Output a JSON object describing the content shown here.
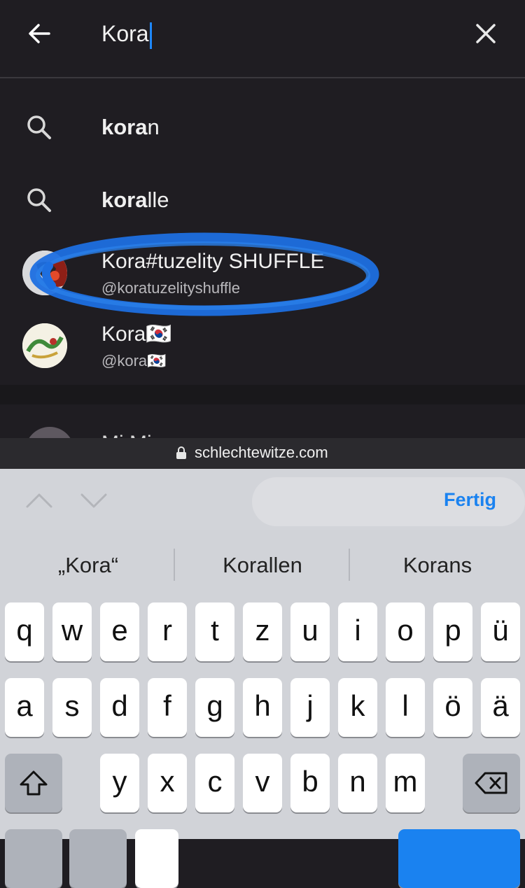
{
  "search": {
    "query": "Kora"
  },
  "suggestions": [
    {
      "bold": "kora",
      "rest": "n"
    },
    {
      "bold": "kora",
      "rest": "lle"
    }
  ],
  "users": [
    {
      "name": "Kora#tuzelity SHUFFLE",
      "handle": "@koratuzelityshuffle"
    },
    {
      "name": "Kora🇰🇷",
      "handle": "@kora🇰🇷"
    }
  ],
  "cutoff_row": {
    "partial_text": "Mi Mi"
  },
  "url_bar": {
    "domain": "schlechtewitze.com"
  },
  "accessory": {
    "done_label": "Fertig"
  },
  "predictions": [
    "„Kora“",
    "Korallen",
    "Korans"
  ],
  "keyboard": {
    "row1": [
      "q",
      "w",
      "e",
      "r",
      "t",
      "z",
      "u",
      "i",
      "o",
      "p",
      "ü"
    ],
    "row2": [
      "a",
      "s",
      "d",
      "f",
      "g",
      "h",
      "j",
      "k",
      "l",
      "ö",
      "ä"
    ],
    "row3": [
      "y",
      "x",
      "c",
      "v",
      "b",
      "n",
      "m"
    ]
  },
  "colors": {
    "accent": "#1a82f0",
    "highlight_scribble": "#1e6fe0"
  }
}
